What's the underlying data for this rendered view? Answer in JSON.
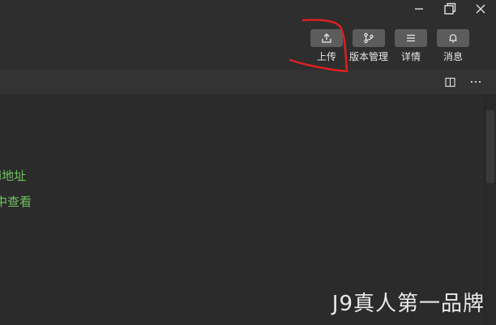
{
  "toolbar": {
    "items": [
      {
        "label": "上传",
        "icon": "upload-icon"
      },
      {
        "label": "版本管理",
        "icon": "branch-icon"
      },
      {
        "label": "详情",
        "icon": "menu-icon"
      },
      {
        "label": "消息",
        "icon": "bell-icon"
      }
    ]
  },
  "window": {
    "controls": [
      "minimize-icon",
      "restore-icon",
      "close-icon"
    ]
  },
  "editor": {
    "header_icons": [
      "split-editor-icon",
      "more-icon"
    ],
    "lines": [
      "i地址",
      "中查看"
    ]
  },
  "watermark": "J9真人第一品牌",
  "colors": {
    "background": "#2b2b2b",
    "code_green": "#6fc15f",
    "annotation_red": "#e21f1f",
    "button_fill": "#5c5c5c"
  }
}
